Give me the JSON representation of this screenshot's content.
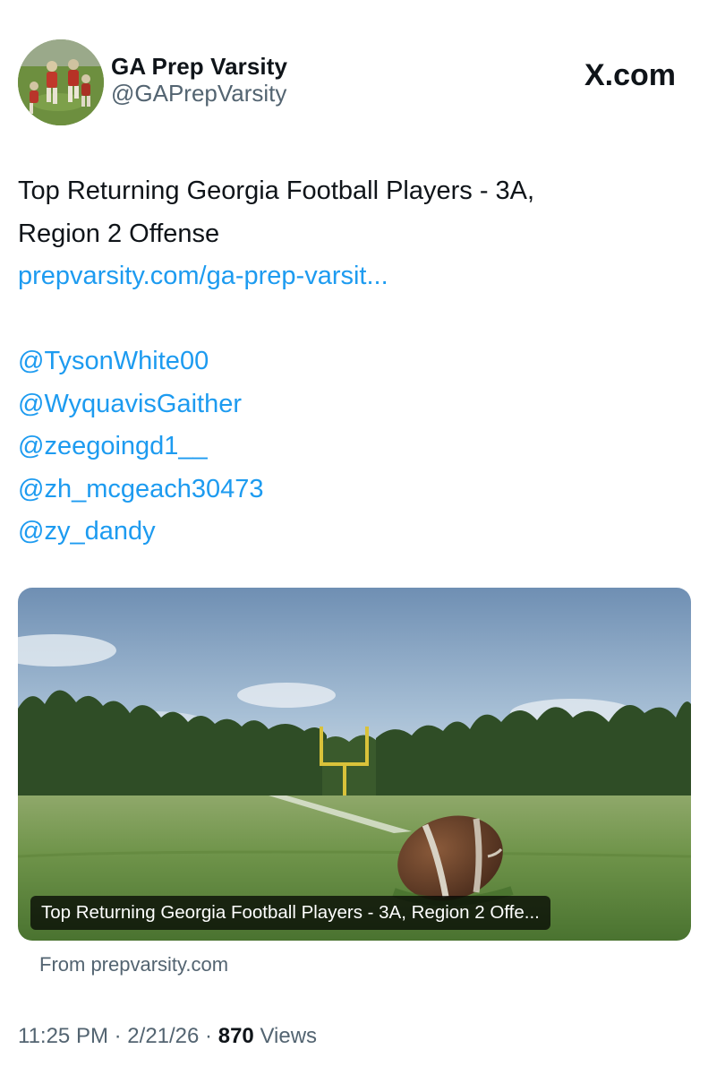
{
  "header": {
    "display_name": "GA Prep Varsity",
    "handle": "@GAPrepVarsity",
    "brand": "X.com"
  },
  "tweet": {
    "text_line1": "Top Returning Georgia Football Players - 3A,",
    "text_line2": "Region 2 Offense",
    "link": "prepvarsity.com/ga-prep-varsit...",
    "mentions": [
      "@TysonWhite00",
      "@WyquavisGaither",
      "@zeegoingd1__",
      "@zh_mcgeach30473",
      "@zy_dandy"
    ]
  },
  "card": {
    "caption": "Top Returning Georgia Football Players - 3A, Region 2 Offe...",
    "source": "From prepvarsity.com"
  },
  "meta": {
    "time": "11:25 PM",
    "sep1": "·",
    "date": "2/21/26",
    "sep2": "·",
    "views_count": "870",
    "views_label": "Views"
  },
  "colors": {
    "link": "#1d9bf0",
    "secondary_text": "#536471",
    "primary_text": "#0f1419"
  }
}
